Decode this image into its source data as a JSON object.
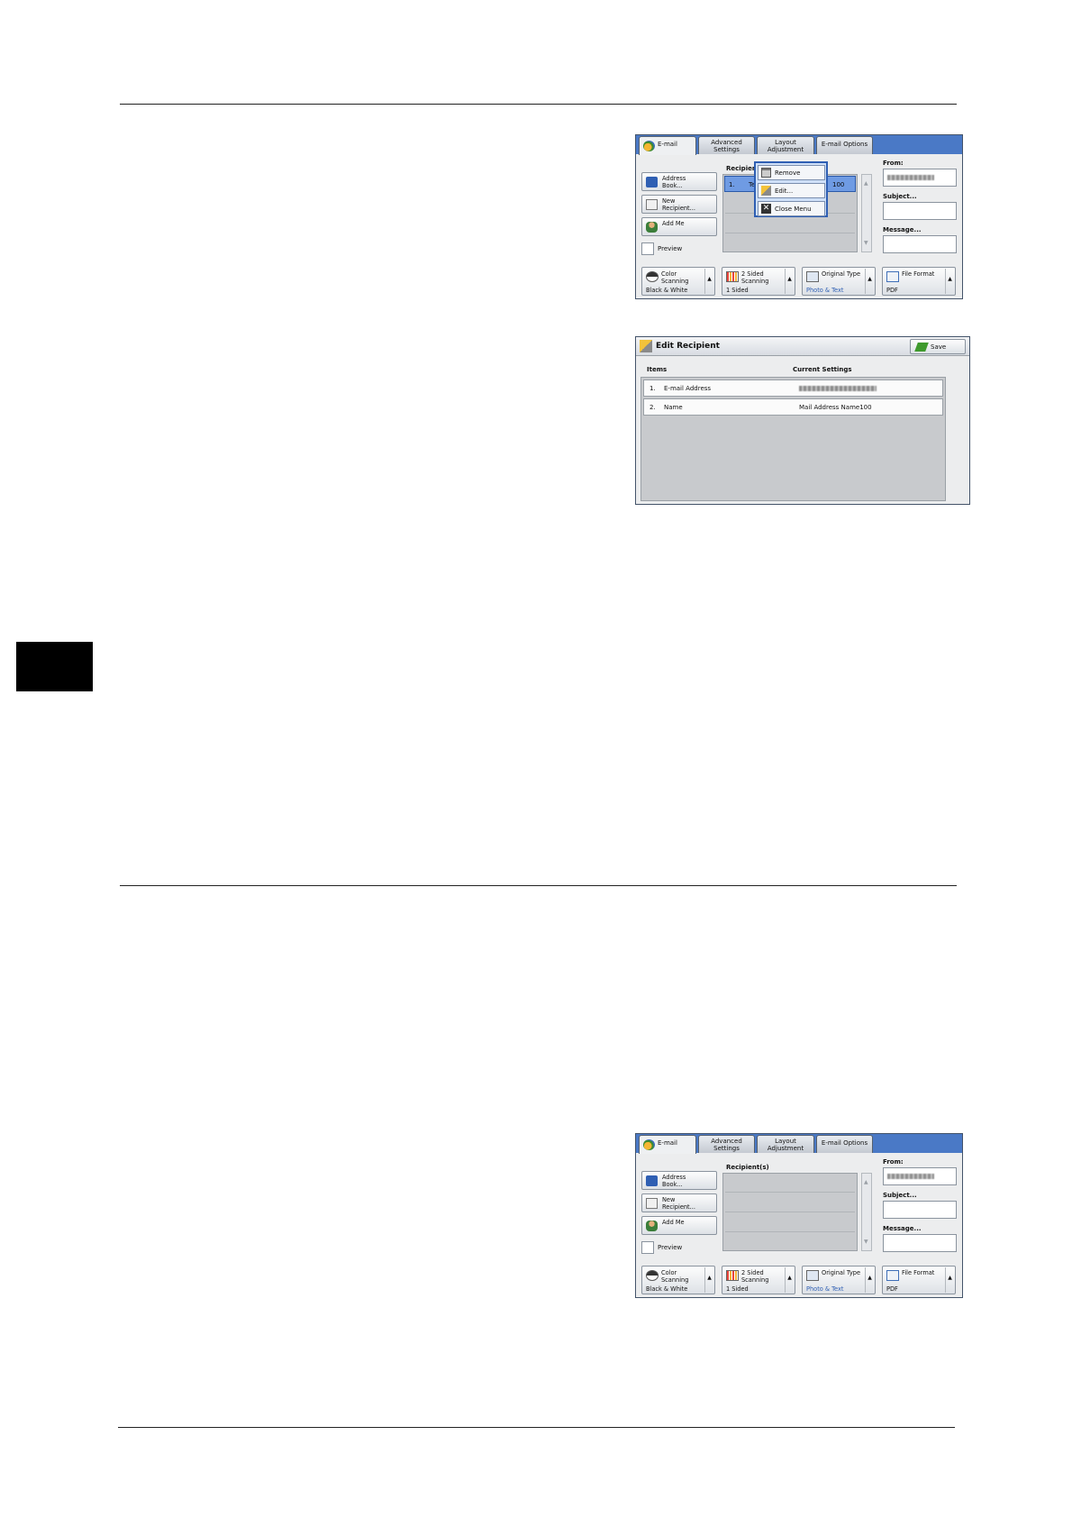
{
  "screen_top": {
    "tabs": [
      "E-mail",
      "Advanced\nSettings",
      "Layout\nAdjustment",
      "E-mail Options"
    ],
    "side_buttons": [
      "Address\nBook...",
      "New\nRecipient...",
      "Add Me"
    ],
    "preview": "Preview",
    "recipients_label": "Recipient(s)",
    "recipient_row": {
      "num": "1.",
      "text": "Te",
      "suffix": "100"
    },
    "popup": [
      "Remove",
      "Edit...",
      "Close Menu"
    ],
    "from_label": "From:",
    "subject_label": "Subject...",
    "message_label": "Message...",
    "bottom_buttons": [
      {
        "title": "Color\nScanning",
        "value": "Black & White",
        "icon": "half-circle-icon"
      },
      {
        "title": "2 Sided\nScanning",
        "value": "1 Sided",
        "icon": "duplex-icon"
      },
      {
        "title": "Original Type",
        "value": "Photo & Text",
        "icon": "original-type-icon"
      },
      {
        "title": "File Format",
        "value": "PDF",
        "icon": "file-format-icon"
      }
    ]
  },
  "edit_recipient": {
    "title": "Edit Recipient",
    "save": "Save",
    "col_items": "Items",
    "col_current": "Current Settings",
    "rows": [
      {
        "num": "1.",
        "item": "E-mail Address",
        "value": ""
      },
      {
        "num": "2.",
        "item": "Name",
        "value": "Mail Address Name100"
      }
    ]
  },
  "screen_bottom": {
    "tabs": [
      "E-mail",
      "Advanced\nSettings",
      "Layout\nAdjustment",
      "E-mail Options"
    ],
    "side_buttons": [
      "Address\nBook...",
      "New\nRecipient...",
      "Add Me"
    ],
    "preview": "Preview",
    "recipients_label": "Recipient(s)",
    "from_label": "From:",
    "subject_label": "Subject...",
    "message_label": "Message...",
    "bottom_buttons": [
      {
        "title": "Color\nScanning",
        "value": "Black & White"
      },
      {
        "title": "2 Sided\nScanning",
        "value": "1 Sided"
      },
      {
        "title": "Original Type",
        "value": "Photo & Text"
      },
      {
        "title": "File Format",
        "value": "PDF"
      }
    ]
  }
}
